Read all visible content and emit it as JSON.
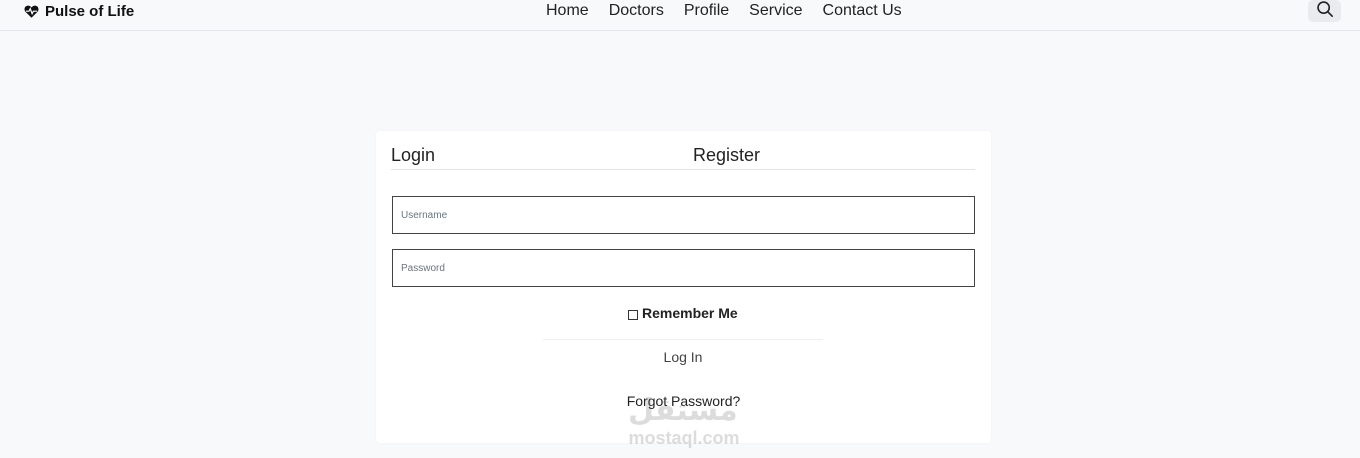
{
  "navbar": {
    "brand_name": "Pulse of Life",
    "brand_icon": "heart-pulse-icon",
    "links": [
      {
        "label": "Home"
      },
      {
        "label": "Doctors"
      },
      {
        "label": "Profile"
      },
      {
        "label": "Service"
      },
      {
        "label": "Contact Us"
      }
    ],
    "search_icon": "search-icon"
  },
  "auth": {
    "tabs": {
      "login": "Login",
      "register": "Register"
    },
    "username_placeholder": "Username",
    "password_placeholder": "Password",
    "remember_label": "Remember Me",
    "remember_checked": false,
    "login_button": "Log In",
    "forgot_link": "Forgot Password?"
  },
  "watermark": {
    "arabic": "مستقل",
    "latin": "mostaql.com"
  },
  "colors": {
    "page_background": "#f8f9fb",
    "card_background": "#ffffff",
    "search_button": "#e9ecef"
  }
}
